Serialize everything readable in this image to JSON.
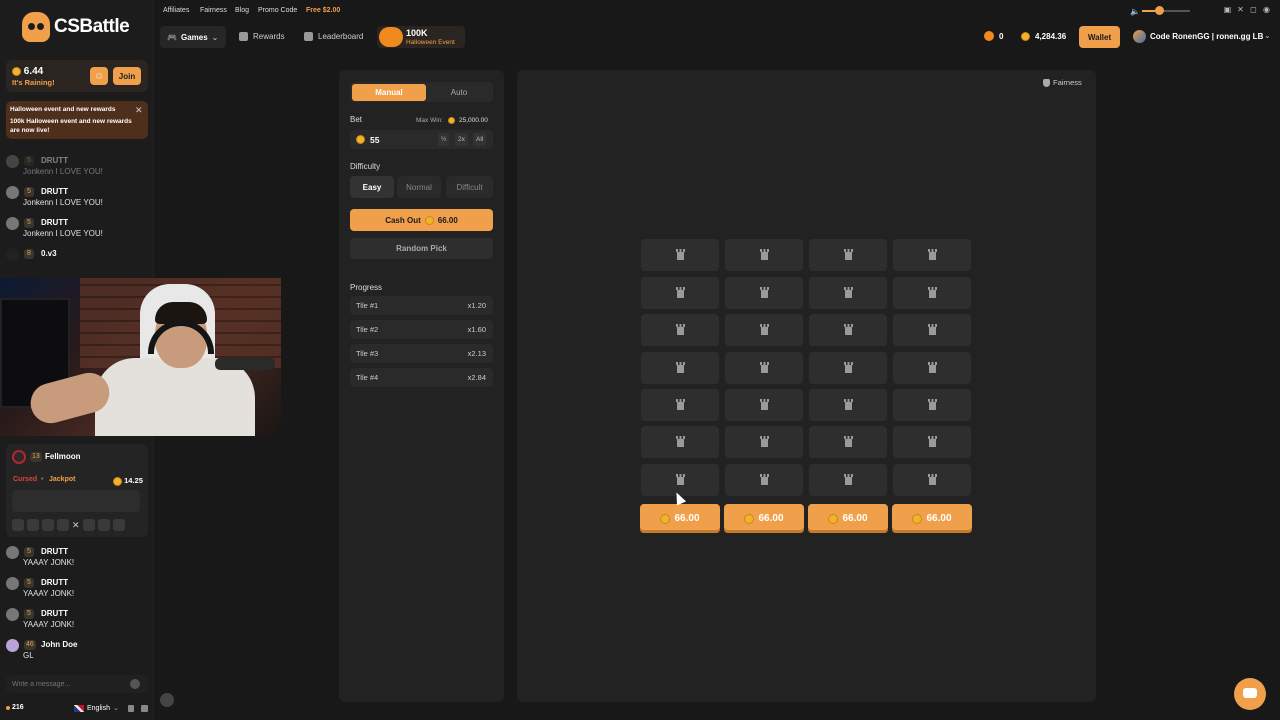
{
  "brand": {
    "name": "CSBattle"
  },
  "top_links": [
    "Affiliates",
    "Fairness",
    "Blog",
    "Promo Code",
    "Free $2.00"
  ],
  "nav": {
    "games": "Games",
    "rewards": "Rewards",
    "leaderboard": "Leaderboard",
    "event_title": "100K",
    "event_sub": "Halloween Event"
  },
  "account": {
    "pumpkins": "0",
    "balance": "4,284.36",
    "wallet": "Wallet",
    "username": "Code RonenGG | ronen.gg LB"
  },
  "rain": {
    "amount": "6.44",
    "subtitle": "It's Raining!",
    "join": "Join"
  },
  "notice": {
    "title": "Halloween event and new rewards",
    "body": "100k Halloween event and new rewards are now live!"
  },
  "chat_top": [
    {
      "level": "5",
      "name": "DRUTT",
      "text": "Jonkenn I LOVE YOU!"
    },
    {
      "level": "5",
      "name": "DRUTT",
      "text": "Jonkenn I LOVE YOU!"
    },
    {
      "level": "5",
      "name": "DRUTT",
      "text": "Jonkenn I LOVE YOU!"
    },
    {
      "level": "8",
      "name": "0.v3",
      "text": ""
    }
  ],
  "win": {
    "level": "13",
    "name": "Fellmoon",
    "cursed": "Cursed",
    "dot": "•",
    "jackpot": "Jackpot",
    "amount": "14.25"
  },
  "chat_bottom": [
    {
      "level": "5",
      "name": "DRUTT",
      "text": "YAAAY JONK!"
    },
    {
      "level": "5",
      "name": "DRUTT",
      "text": "YAAAY JONK!"
    },
    {
      "level": "5",
      "name": "DRUTT",
      "text": "YAAAY JONK!"
    },
    {
      "level": "46",
      "name": "John Doe",
      "text": "GL"
    }
  ],
  "chat_input": {
    "placeholder": "Write a message..."
  },
  "footer": {
    "online": "216",
    "language": "English"
  },
  "bet_panel": {
    "manual": "Manual",
    "auto": "Auto",
    "bet_label": "Bet",
    "max_win_label": "Max Win:",
    "max_win": "25,000.00",
    "bet_value": "55",
    "half": "½",
    "double": "2x",
    "all": "All",
    "difficulty_label": "Difficulty",
    "difficulties": [
      "Easy",
      "Normal",
      "Difficult"
    ],
    "cashout_label": "Cash Out",
    "cashout_amount": "66.00",
    "random_pick": "Random Pick",
    "progress_label": "Progress",
    "progress": [
      {
        "tile": "Tile #1",
        "mult": "x1.20"
      },
      {
        "tile": "Tile #2",
        "mult": "x1.60"
      },
      {
        "tile": "Tile #3",
        "mult": "x2.13"
      },
      {
        "tile": "Tile #4",
        "mult": "x2.84"
      }
    ]
  },
  "board": {
    "fairness": "Fairness",
    "payout": "66.00"
  },
  "colors": {
    "accent": "#f0a04b",
    "background": "#181818",
    "panel": "#222222",
    "tile": "#2e2e2e"
  }
}
